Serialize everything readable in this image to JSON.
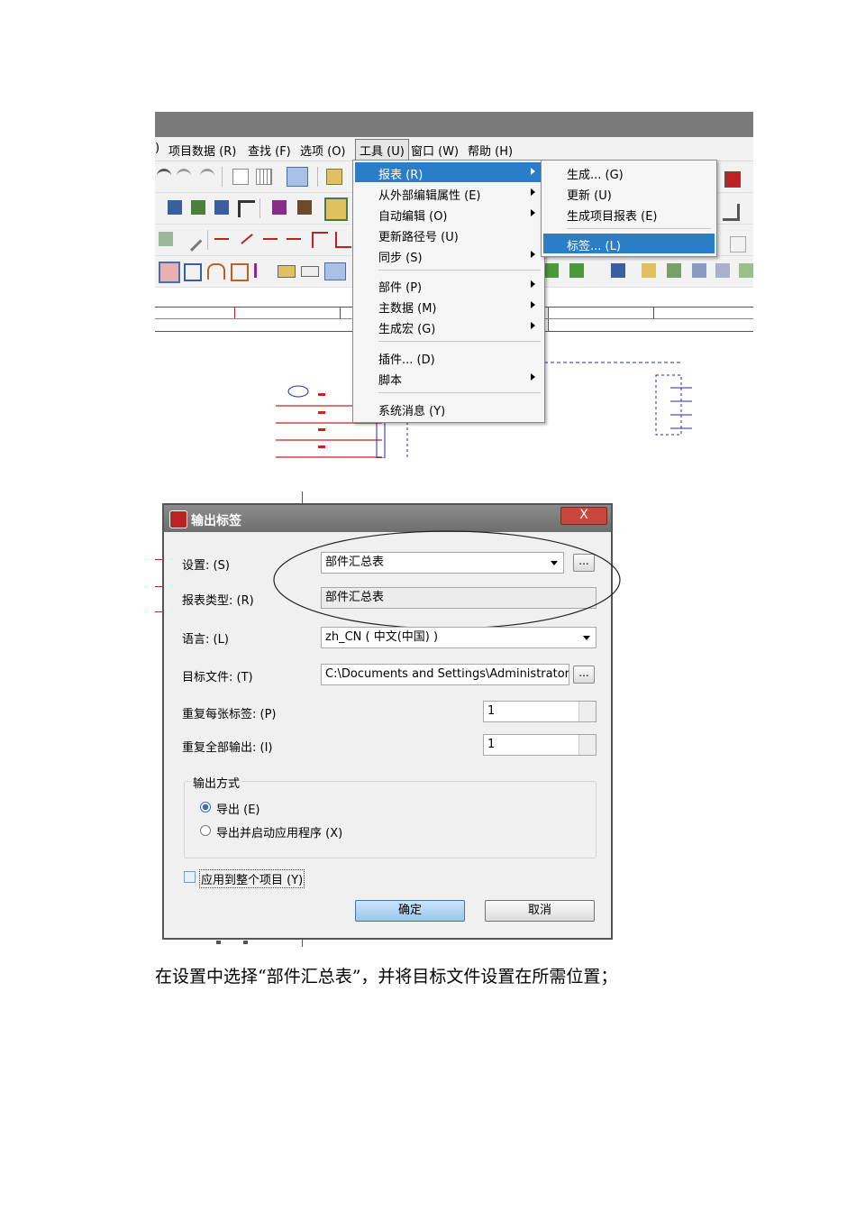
{
  "top_menu": {
    "items": [
      "项目数据 (R)",
      "查找 (F)",
      "选项 (O)",
      "工具 (U)",
      "窗口 (W)",
      "帮助 (H)"
    ]
  },
  "tools_menu": {
    "items": [
      {
        "label": "报表 (R)",
        "submenu": true
      },
      {
        "label": "从外部编辑属性 (E)",
        "submenu": true
      },
      {
        "label": "自动编辑 (O)",
        "submenu": true
      },
      {
        "label": "更新路径号 (U)",
        "submenu": false
      },
      {
        "label": "同步 (S)",
        "submenu": true
      },
      {
        "label": "部件 (P)",
        "submenu": true
      },
      {
        "label": "主数据 (M)",
        "submenu": true
      },
      {
        "label": "生成宏 (G)",
        "submenu": true
      },
      {
        "label": "插件... (D)",
        "submenu": false
      },
      {
        "label": "脚本",
        "submenu": true
      },
      {
        "label": "系统消息 (Y)",
        "submenu": false
      }
    ]
  },
  "report_submenu": {
    "items": [
      "生成... (G)",
      "更新 (U)",
      "生成项目报表 (E)",
      "标签... (L)"
    ]
  },
  "dialog": {
    "title": "输出标签",
    "close_label": "X",
    "settings_label": "设置: (S)",
    "settings_value": "部件汇总表",
    "browse_label": "...",
    "report_type_label": "报表类型: (R)",
    "report_type_value": "部件汇总表",
    "language_label": "语言: (L)",
    "language_value": "zh_CN ( 中文(中国) )",
    "target_file_label": "目标文件: (T)",
    "target_file_value": "C:\\Documents and Settings\\Administrator\\桌面",
    "repeat_each_label": "重复每张标签: (P)",
    "repeat_each_value": "1",
    "repeat_all_label": "重复全部输出: (I)",
    "repeat_all_value": "1",
    "output_group_label": "输出方式",
    "export_label": "导出 (E)",
    "export_launch_label": "导出并启动应用程序 (X)",
    "apply_project_label": "应用到整个项目 (Y)",
    "ok_label": "确定",
    "cancel_label": "取消"
  },
  "caption": "在设置中选择“部件汇总表”，并将目标文件设置在所需位置；",
  "colors": {
    "menu_highlight": "#2a7ec8",
    "schematic_red": "#cc1f1f",
    "schematic_blue": "#1f2aa8"
  }
}
